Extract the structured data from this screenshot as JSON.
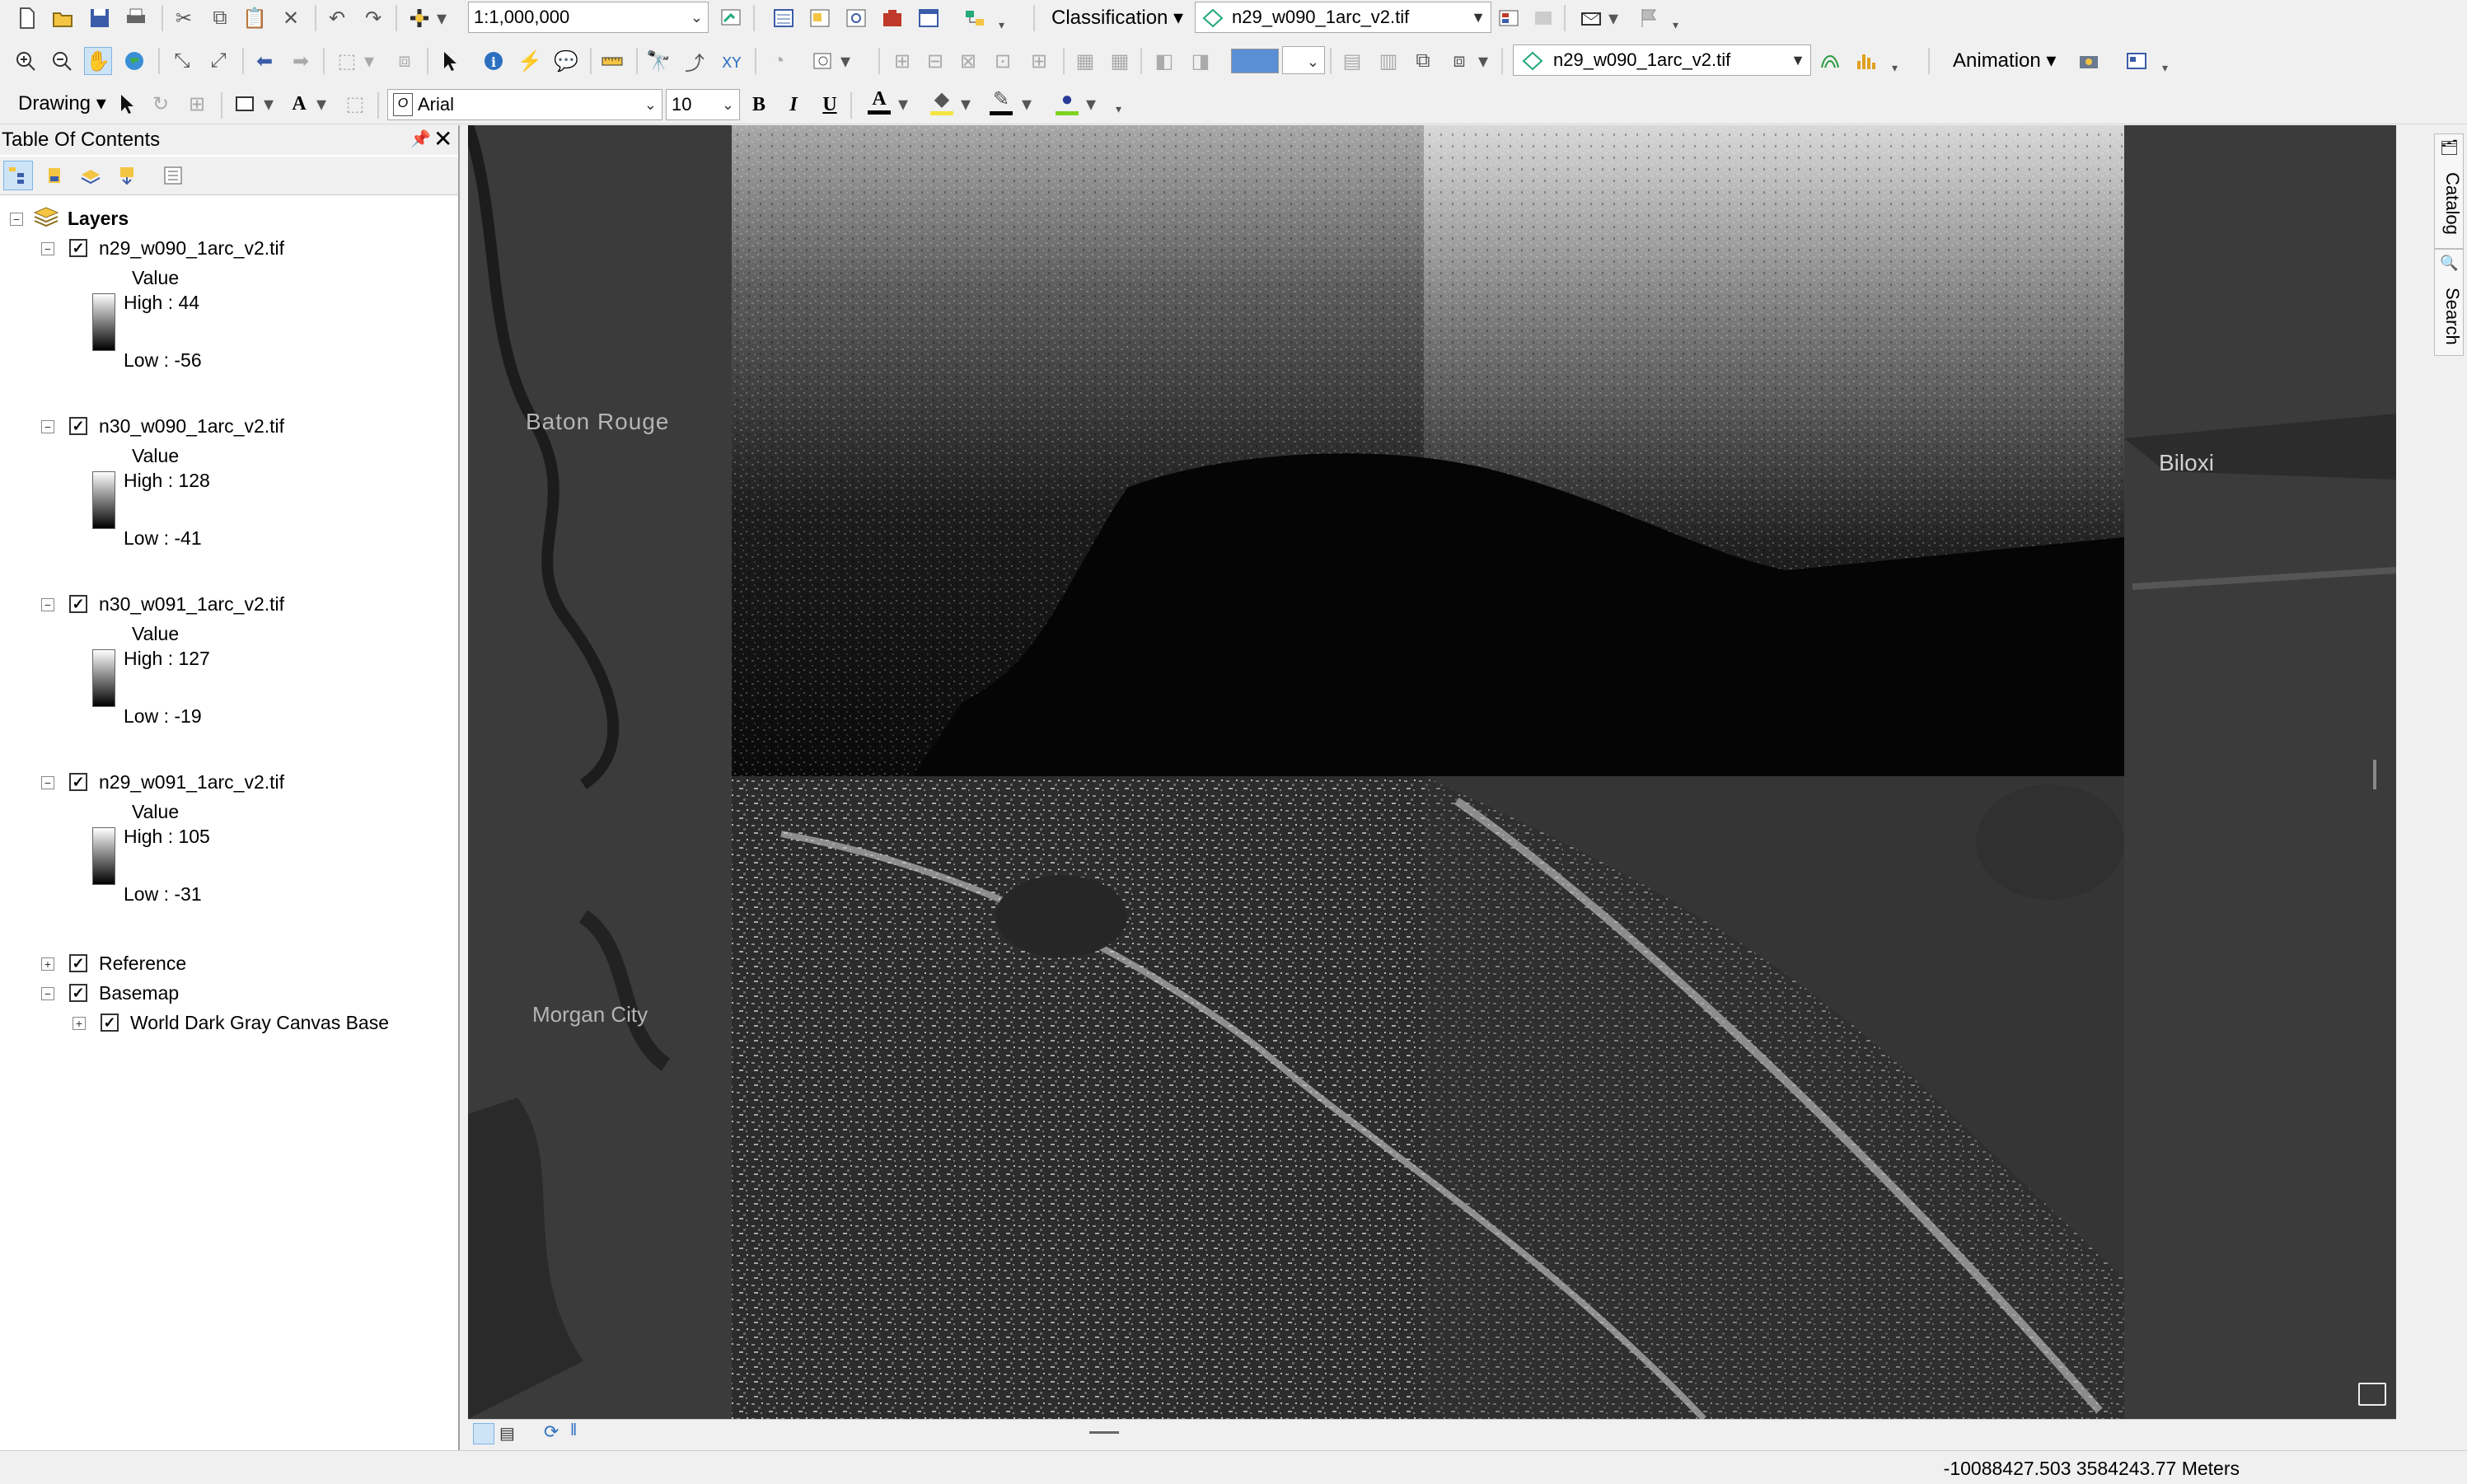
{
  "toolbar_standard": {
    "scale_value": "1:1,000,000",
    "classification_label": "Classification",
    "layer_select_1": "n29_w090_1arc_v2.tif"
  },
  "toolbar_tools": {
    "layer_select_2": "n29_w090_1arc_v2.tif",
    "animation_label": "Animation"
  },
  "toolbar_draw": {
    "drawing_label": "Drawing",
    "font_name": "Arial",
    "font_size": "10",
    "bold": "B",
    "italic": "I",
    "underline": "U",
    "font_color_letter": "A"
  },
  "toc": {
    "title": "Table Of Contents",
    "root": "Layers",
    "layers": [
      {
        "name": "n29_w090_1arc_v2.tif",
        "value_label": "Value",
        "high": "High : 44",
        "low": "Low : -56"
      },
      {
        "name": "n30_w090_1arc_v2.tif",
        "value_label": "Value",
        "high": "High : 128",
        "low": "Low : -41"
      },
      {
        "name": "n30_w091_1arc_v2.tif",
        "value_label": "Value",
        "high": "High : 127",
        "low": "Low : -19"
      },
      {
        "name": "n29_w091_1arc_v2.tif",
        "value_label": "Value",
        "high": "High : 105",
        "low": "Low : -31"
      }
    ],
    "groups": {
      "reference": "Reference",
      "basemap": "Basemap",
      "basemap_child": "World Dark Gray Canvas Base"
    }
  },
  "map": {
    "labels": {
      "baton_rouge": "Baton Rouge",
      "biloxi": "Biloxi",
      "morgan_city": "Morgan City"
    }
  },
  "dock": {
    "catalog": "Catalog",
    "search": "Search"
  },
  "status": {
    "coords": "-10088427.503  3584243.77 Meters"
  }
}
